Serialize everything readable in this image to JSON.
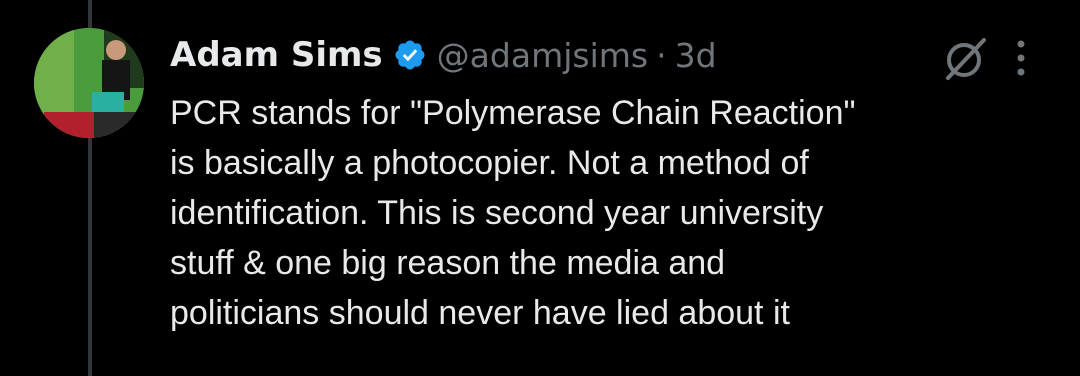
{
  "tweet": {
    "author_name": "Adam Sims",
    "handle": "@adamjsims",
    "separator": "·",
    "time": "3d",
    "verified": true,
    "text_lines": [
      "PCR stands for \"Polymerase Chain Reaction\"",
      "is basically a photocopier. Not a method of",
      "identification. This is second year university",
      "stuff & one big reason the media and",
      "politicians should never have lied about it"
    ]
  },
  "icons": {
    "verified": "verified-badge-icon",
    "grok": "grok-icon",
    "more": "more-options-icon"
  },
  "colors": {
    "background": "#000000",
    "primary_text": "#e7e9ea",
    "secondary_text": "#71767b",
    "verified_blue": "#1d9bf0",
    "thread_line": "#333639"
  }
}
